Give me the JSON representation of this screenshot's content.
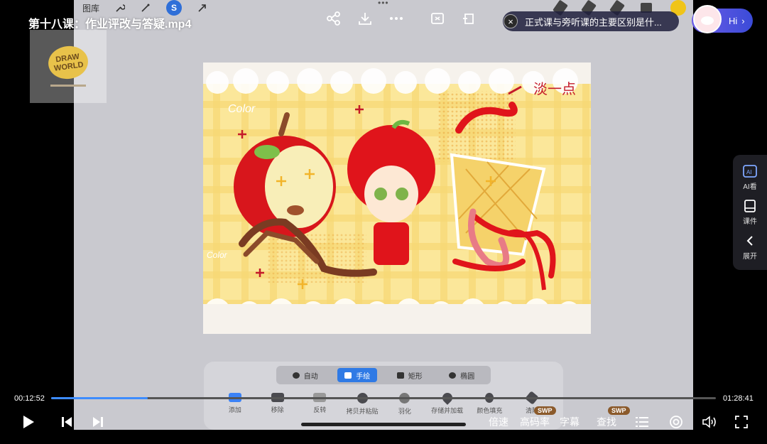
{
  "header": {
    "title": "第十八课：作业评改与答疑.mp4"
  },
  "ipad_topbar": {
    "gallery_label": "图库",
    "blue_tool_letter": "S"
  },
  "thumbnail": {
    "logo_text": "DRAW WORLD"
  },
  "artwork": {
    "annotation_light": "淡一点",
    "sticker_text_1": "Color",
    "sticker_text_2": "Color"
  },
  "qa": {
    "close_symbol": "×",
    "question": "正式课与旁听课的主要区别是什..."
  },
  "assistant": {
    "label": "Hi"
  },
  "side_panel": {
    "items": [
      {
        "label": "AI看",
        "icon": "ai-view-icon"
      },
      {
        "label": "课件",
        "icon": "courseware-icon"
      },
      {
        "label": "展开",
        "icon": "chevron-left-icon"
      }
    ]
  },
  "selection_panel": {
    "modes": [
      {
        "label": "自动",
        "icon": "auto-icon"
      },
      {
        "label": "手绘",
        "icon": "freehand-icon"
      },
      {
        "label": "矩形",
        "icon": "rectangle-icon"
      },
      {
        "label": "椭圆",
        "icon": "ellipse-icon"
      }
    ],
    "active_mode": "手绘",
    "actions": [
      {
        "label": "添加",
        "icon": "add-icon"
      },
      {
        "label": "移除",
        "icon": "remove-icon"
      },
      {
        "label": "反转",
        "icon": "invert-icon"
      },
      {
        "label": "拷贝并粘贴",
        "icon": "copy-paste-icon"
      },
      {
        "label": "羽化",
        "icon": "feather-icon"
      },
      {
        "label": "存储并加载",
        "icon": "save-load-icon"
      },
      {
        "label": "颜色填充",
        "icon": "color-fill-icon"
      },
      {
        "label": "清除",
        "icon": "clear-icon"
      }
    ]
  },
  "player": {
    "current_time": "00:12:52",
    "total_time": "01:28:41",
    "progress_fraction": 0.145,
    "speed_label": "倍速",
    "quality_label": "高码率",
    "subtitle_label": "字幕",
    "search_label": "查找",
    "swp_badge": "SWP"
  },
  "colors": {
    "accent": "#3d8cff",
    "assistant_gradient_start": "#6c5ce7",
    "assistant_gradient_end": "#3b4bd8"
  }
}
